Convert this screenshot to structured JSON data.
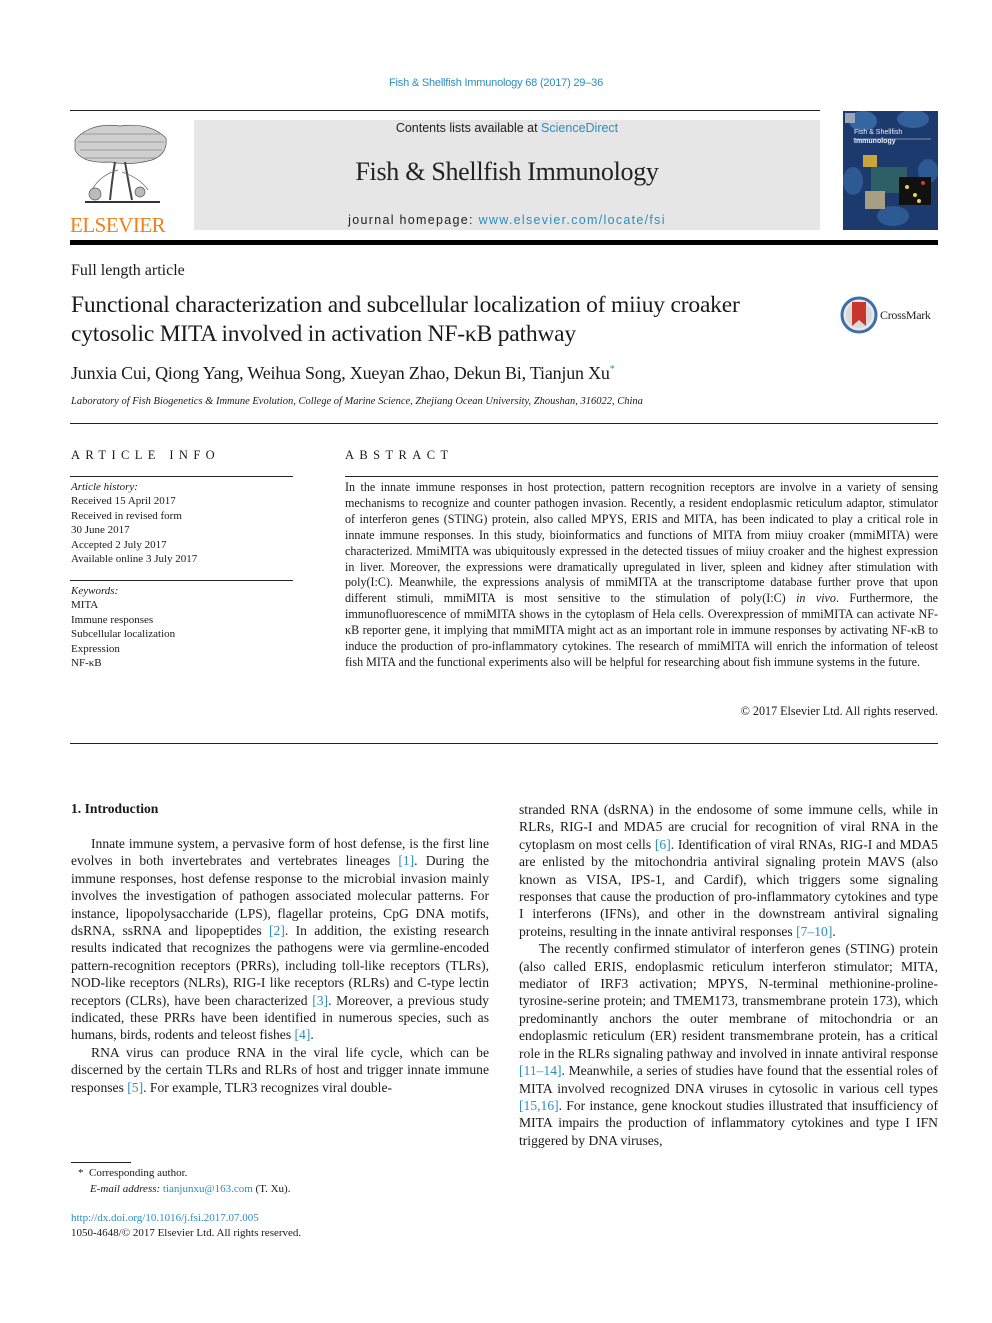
{
  "header": {
    "citation": "Fish & Shellfish Immunology 68 (2017) 29–36",
    "contents_prefix": "Contents lists available at ",
    "contents_link": "ScienceDirect",
    "journal_name": "Fish & Shellfish Immunology",
    "homepage_prefix": "journal homepage: ",
    "homepage_link": "www.elsevier.com/locate/fsi",
    "publisher_logo": "ELSEVIER",
    "cover_title_line1": "Fish & Shellfish",
    "cover_title_line2": "Immunology",
    "brand_color": "#f0801a",
    "link_color": "#2a8ec0"
  },
  "article": {
    "type": "Full length article",
    "title": "Functional characterization and subcellular localization of miiuy croaker cytosolic MITA involved in activation NF-κB pathway",
    "crossmark_label": "CrossMark",
    "authors": "Junxia Cui, Qiong Yang, Weihua Song, Xueyan Zhao, Dekun Bi, Tianjun Xu",
    "corresponding_mark": "*",
    "affiliation": "Laboratory of Fish Biogenetics & Immune Evolution, College of Marine Science, Zhejiang Ocean University, Zhoushan, 316022, China"
  },
  "article_info": {
    "heading": "ARTICLE INFO",
    "history_label": "Article history:",
    "history": [
      "Received 15 April 2017",
      "Received in revised form",
      "30 June 2017",
      "Accepted 2 July 2017",
      "Available online 3 July 2017"
    ],
    "keywords_label": "Keywords:",
    "keywords": [
      "MITA",
      "Immune responses",
      "Subcellular localization",
      "Expression",
      "NF-κB"
    ]
  },
  "abstract": {
    "heading": "ABSTRACT",
    "text_part1": "In the innate immune responses in host protection, pattern recognition receptors are involve in a variety of sensing mechanisms to recognize and counter pathogen invasion. Recently, a resident endoplasmic reticulum adaptor, stimulator of interferon genes (STING) protein, also called MPYS, ERIS and MITA, has been indicated to play a critical role in innate immune responses. In this study, bioinformatics and functions of MITA from miiuy croaker (mmiMITA) were characterized. MmiMITA was ubiquitously expressed in the detected tissues of miiuy croaker and the highest expression in liver. Moreover, the expressions were dramatically upregulated in liver, spleen and kidney after stimulation with poly(I:C). Meanwhile, the expressions analysis of mmiMITA at the transcriptome database further prove that upon different stimuli, mmiMITA is most sensitive to the stimulation of poly(I:C) ",
    "text_italic": "in vivo",
    "text_part2": ". Furthermore, the immunofluorescence of mmiMITA shows in the cytoplasm of Hela cells. Overexpression of mmiMITA can activate NF-κB reporter gene, it implying that mmiMITA might act as an important role in immune responses by activating NF-κB to induce the production of pro-inflammatory cytokines. The research of mmiMITA will enrich the information of teleost fish MITA and the functional experiments also will be helpful for researching about fish immune systems in the future.",
    "copyright": "© 2017 Elsevier Ltd. All rights reserved."
  },
  "intro": {
    "heading": "1.  Introduction",
    "p1": [
      "Innate immune system, a pervasive form of host defense, is the first line evolves in both invertebrates and vertebrates lineages ",
      "[1]",
      ". During the immune responses, host defense response to the microbial invasion mainly involves the investigation of pathogen associated molecular patterns. For instance, lipopolysaccharide (LPS), flagellar proteins, CpG DNA motifs, dsRNA, ssRNA and lipopeptides ",
      "[2]",
      ". In addition, the existing research results indicated that recognizes the pathogens were via germline-encoded pattern-recognition receptors (PRRs), including toll-like receptors (TLRs), NOD-like receptors (NLRs), RIG-I like receptors (RLRs) and C-type lectin receptors (CLRs), have been characterized ",
      "[3]",
      ". Moreover, a previous study indicated, these PRRs have been identified in numerous species, such as humans, birds, rodents and teleost fishes ",
      "[4]",
      "."
    ],
    "p2": [
      "RNA virus can produce RNA in the viral life cycle, which can be discerned by the certain TLRs and RLRs of host and trigger innate immune responses ",
      "[5]",
      ". For example, TLR3 recognizes viral double-"
    ],
    "p2_cont": [
      "stranded RNA (dsRNA) in the endosome of some immune cells, while in RLRs, RIG-I and MDA5 are crucial for recognition of viral RNA in the cytoplasm on most cells ",
      "[6]",
      ". Identification of viral RNAs, RIG-I and MDA5 are enlisted by the mitochondria antiviral signaling protein MAVS (also known as VISA, IPS-1, and Cardif), which triggers some signaling responses that cause the production of pro-inflammatory cytokines and type I interferons (IFNs), and other in the downstream antiviral signaling proteins, resulting in the innate antiviral responses ",
      "[7–10]",
      "."
    ],
    "p3": [
      "The recently confirmed stimulator of interferon genes (STING) protein (also called ERIS, endoplasmic reticulum interferon stimulator; MITA, mediator of IRF3 activation; MPYS, N-terminal methionine-proline-tyrosine-serine protein; and TMEM173, transmembrane protein 173), which predominantly anchors the outer membrane of mitochondria or an endoplasmic reticulum (ER) resident transmembrane protein, has a critical role in the RLRs signaling pathway and involved in innate antiviral response ",
      "[11–14]",
      ". Meanwhile, a series of studies have found that the essential roles of MITA involved recognized DNA viruses in cytosolic in various cell types ",
      "[15,16]",
      ". For instance, gene knockout studies illustrated that insufficiency of MITA impairs the production of inflammatory cytokines and type I IFN triggered by DNA viruses,"
    ]
  },
  "footnote": {
    "mark": "*",
    "corresponding": "Corresponding author.",
    "email_label": "E-mail address:",
    "email": "tianjunxu@163.com",
    "email_suffix": " (T. Xu).",
    "doi": "http://dx.doi.org/10.1016/j.fsi.2017.07.005",
    "issn": "1050-4648/© 2017 Elsevier Ltd. All rights reserved."
  }
}
